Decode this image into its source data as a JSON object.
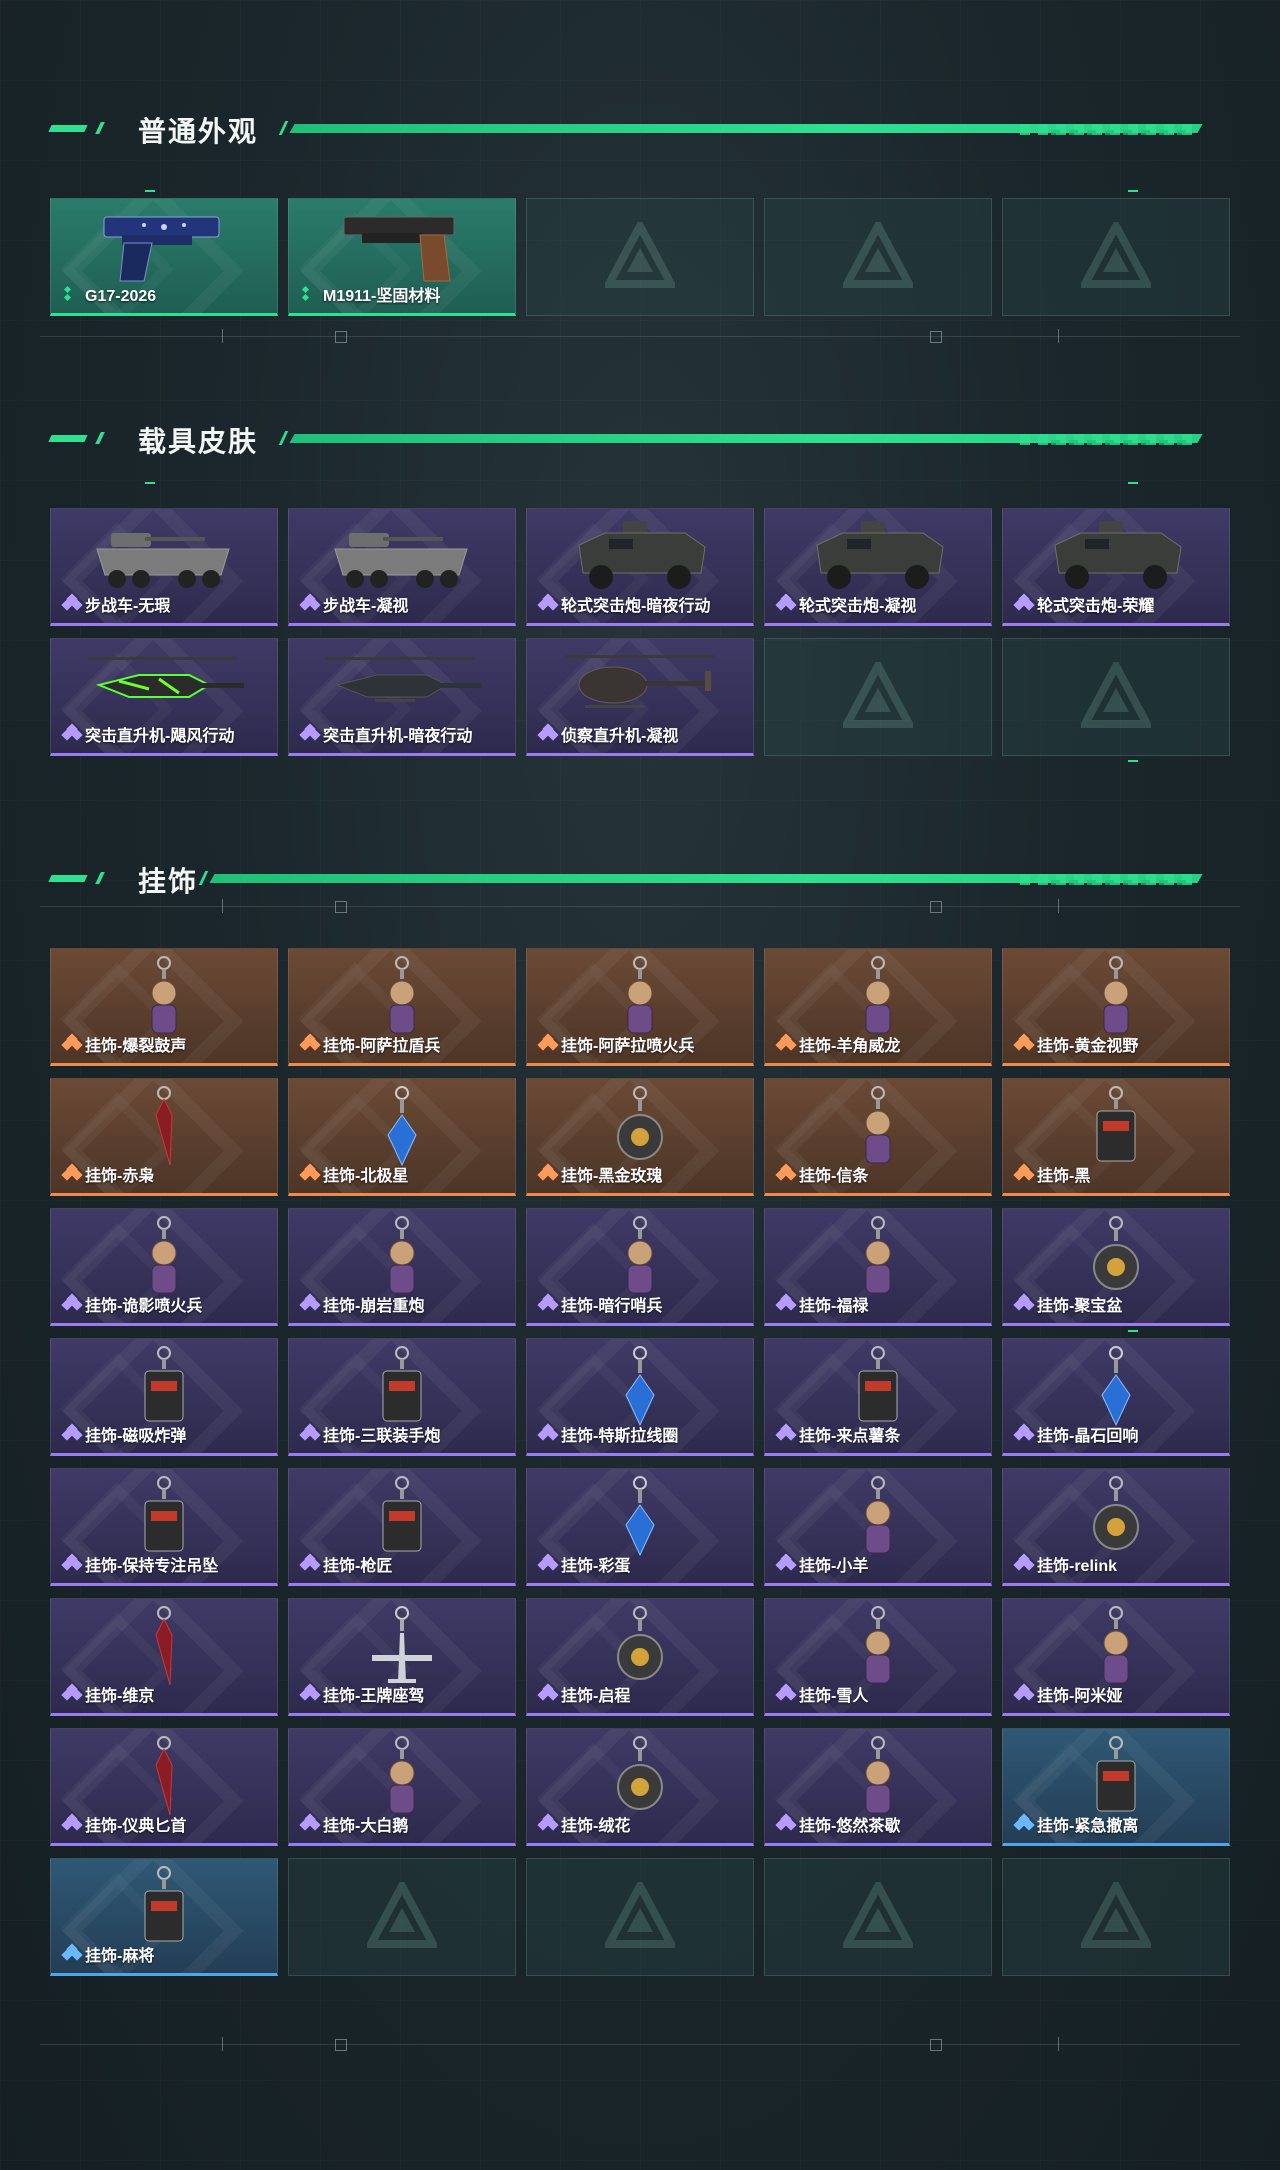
{
  "colors": {
    "accent": "#2ee08f",
    "rarity_green": "#2ee08f",
    "rarity_purple": "#9b7cf0",
    "rarity_orange": "#f08a4b",
    "rarity_blue": "#4fa6e8"
  },
  "sections": [
    {
      "title": "普通外观",
      "items": [
        {
          "label": "G17-2026",
          "rarity": "green",
          "art": "pistol-blue"
        },
        {
          "label": "M1911-坚固材料",
          "rarity": "green",
          "art": "pistol-dark"
        },
        {
          "empty": true
        },
        {
          "empty": true
        },
        {
          "empty": true
        }
      ]
    },
    {
      "title": "载具皮肤",
      "items": [
        {
          "label": "步战车-无瑕",
          "rarity": "purple",
          "art": "ifv"
        },
        {
          "label": "步战车-凝视",
          "rarity": "purple",
          "art": "ifv"
        },
        {
          "label": "轮式突击炮-暗夜行动",
          "rarity": "purple",
          "art": "armored-car"
        },
        {
          "label": "轮式突击炮-凝视",
          "rarity": "purple",
          "art": "armored-car"
        },
        {
          "label": "轮式突击炮-荣耀",
          "rarity": "purple",
          "art": "armored-car"
        },
        {
          "label": "突击直升机-飓风行动",
          "rarity": "purple",
          "art": "helicopter-green"
        },
        {
          "label": "突击直升机-暗夜行动",
          "rarity": "purple",
          "art": "helicopter"
        },
        {
          "label": "侦察直升机-凝视",
          "rarity": "purple",
          "art": "helicopter-scout"
        },
        {
          "empty": true
        },
        {
          "empty": true
        }
      ]
    },
    {
      "title": "挂饰",
      "items": [
        {
          "label": "挂饰-爆裂鼓声",
          "rarity": "orange",
          "art": "charm-figure"
        },
        {
          "label": "挂饰-阿萨拉盾兵",
          "rarity": "orange",
          "art": "charm-figure"
        },
        {
          "label": "挂饰-阿萨拉喷火兵",
          "rarity": "orange",
          "art": "charm-figure"
        },
        {
          "label": "挂饰-羊角威龙",
          "rarity": "orange",
          "art": "charm-figure"
        },
        {
          "label": "挂饰-黄金视野",
          "rarity": "orange",
          "art": "charm-figure"
        },
        {
          "label": "挂饰-赤枭",
          "rarity": "orange",
          "art": "charm-blade"
        },
        {
          "label": "挂饰-北极星",
          "rarity": "orange",
          "art": "charm-gem"
        },
        {
          "label": "挂饰-黑金玫瑰",
          "rarity": "orange",
          "art": "charm-round"
        },
        {
          "label": "挂饰-信条",
          "rarity": "orange",
          "art": "charm-figure"
        },
        {
          "label": "挂饰-黑",
          "rarity": "orange",
          "art": "charm-tag"
        },
        {
          "label": "挂饰-诡影喷火兵",
          "rarity": "purple",
          "art": "charm-figure"
        },
        {
          "label": "挂饰-崩岩重炮",
          "rarity": "purple",
          "art": "charm-figure"
        },
        {
          "label": "挂饰-暗行哨兵",
          "rarity": "purple",
          "art": "charm-figure"
        },
        {
          "label": "挂饰-福禄",
          "rarity": "purple",
          "art": "charm-figure"
        },
        {
          "label": "挂饰-聚宝盆",
          "rarity": "purple",
          "art": "charm-round"
        },
        {
          "label": "挂饰-磁吸炸弹",
          "rarity": "purple",
          "art": "charm-tag"
        },
        {
          "label": "挂饰-三联装手炮",
          "rarity": "purple",
          "art": "charm-tag"
        },
        {
          "label": "挂饰-特斯拉线圈",
          "rarity": "purple",
          "art": "charm-gem"
        },
        {
          "label": "挂饰-来点薯条",
          "rarity": "purple",
          "art": "charm-tag"
        },
        {
          "label": "挂饰-晶石回响",
          "rarity": "purple",
          "art": "charm-gem"
        },
        {
          "label": "挂饰-保持专注吊坠",
          "rarity": "purple",
          "art": "charm-tag"
        },
        {
          "label": "挂饰-枪匠",
          "rarity": "purple",
          "art": "charm-tag"
        },
        {
          "label": "挂饰-彩蛋",
          "rarity": "purple",
          "art": "charm-gem"
        },
        {
          "label": "挂饰-小羊",
          "rarity": "purple",
          "art": "charm-figure"
        },
        {
          "label": "挂饰-relink",
          "rarity": "purple",
          "art": "charm-round"
        },
        {
          "label": "挂饰-维京",
          "rarity": "purple",
          "art": "charm-blade"
        },
        {
          "label": "挂饰-王牌座驾",
          "rarity": "purple",
          "art": "charm-plane"
        },
        {
          "label": "挂饰-启程",
          "rarity": "purple",
          "art": "charm-round"
        },
        {
          "label": "挂饰-雪人",
          "rarity": "purple",
          "art": "charm-figure"
        },
        {
          "label": "挂饰-阿米娅",
          "rarity": "purple",
          "art": "charm-figure"
        },
        {
          "label": "挂饰-仪典匕首",
          "rarity": "purple",
          "art": "charm-blade"
        },
        {
          "label": "挂饰-大白鹅",
          "rarity": "purple",
          "art": "charm-figure"
        },
        {
          "label": "挂饰-绒花",
          "rarity": "purple",
          "art": "charm-round"
        },
        {
          "label": "挂饰-悠然茶歇",
          "rarity": "purple",
          "art": "charm-figure"
        },
        {
          "label": "挂饰-紧急撤离",
          "rarity": "blue",
          "art": "charm-tag"
        },
        {
          "label": "挂饰-麻将",
          "rarity": "blue",
          "art": "charm-tag"
        },
        {
          "empty": true
        },
        {
          "empty": true
        },
        {
          "empty": true
        },
        {
          "empty": true
        }
      ]
    }
  ]
}
